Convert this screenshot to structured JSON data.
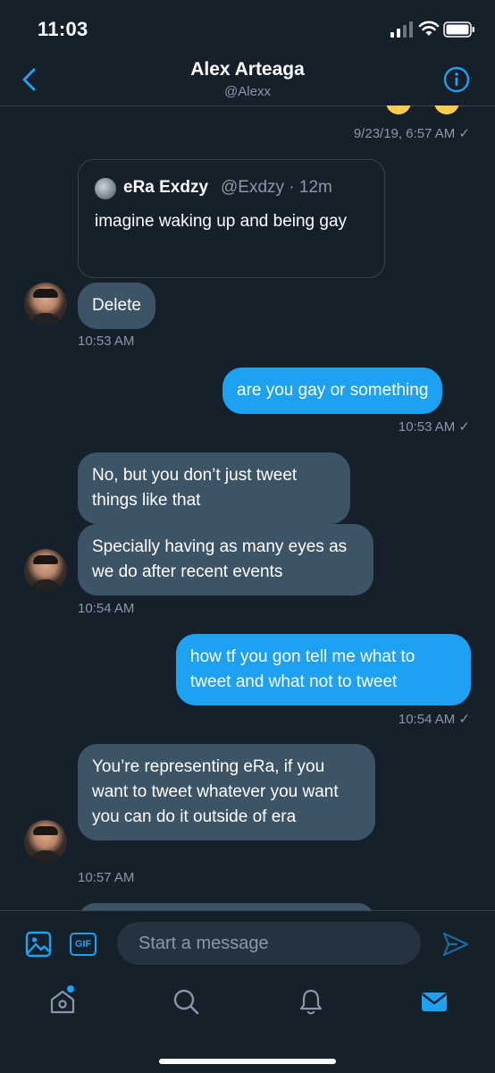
{
  "status_bar": {
    "time": "11:03"
  },
  "header": {
    "title": "Alex Arteaga",
    "handle": "@Alexx"
  },
  "thread": {
    "ts1": "9/23/19, 6:57 AM ✓",
    "quote": {
      "name": "eRa Exdzy",
      "handle": "@Exdzy · 12m",
      "text": "imagine waking up and being gay"
    },
    "msg1": "Delete",
    "ts2": "10:53 AM",
    "msg2": "are you gay or something",
    "ts3": "10:53 AM ✓",
    "msg3": "No, but you don’t just tweet things like that",
    "msg4": "Specially having as many eyes as we do after recent events",
    "ts4": "10:54 AM",
    "msg5": "how tf you gon tell me what to tweet and what not to tweet",
    "ts5": "10:54 AM ✓",
    "msg6": "You’re representing eRa, if you want to tweet whatever you want you can do it outside of era",
    "ts6": "10:57 AM"
  },
  "compose": {
    "placeholder": "Start a message"
  },
  "colors": {
    "background": "#15202b",
    "accent": "#1da1f2",
    "incoming_bubble": "#3d5466",
    "muted_text": "#8899a6"
  },
  "icons": [
    "back-icon",
    "info-icon",
    "image-icon",
    "gif-icon",
    "send-icon",
    "home-icon",
    "search-icon",
    "bell-icon",
    "mail-icon"
  ]
}
